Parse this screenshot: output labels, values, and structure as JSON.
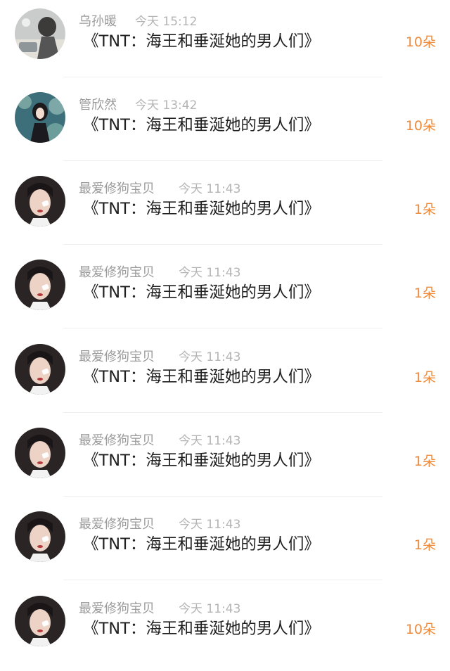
{
  "colors": {
    "username": "#9b9b9b",
    "time": "#b4b4b4",
    "text": "#1f1f1f",
    "accent": "#ef8a3a",
    "divider": "#eeeeee"
  },
  "gift_records": [
    {
      "username": "乌孙暖",
      "time": "今天 15:12",
      "gift": "《TNT：海王和垂涎她的男人们》",
      "count": "10朵",
      "avatar": "avatar-icon-a"
    },
    {
      "username": "管欣然",
      "time": "今天 13:42",
      "gift": "《TNT：海王和垂涎她的男人们》",
      "count": "10朵",
      "avatar": "avatar-icon-b"
    },
    {
      "username": "最爱修狗宝贝",
      "time": "今天 11:43",
      "gift": "《TNT：海王和垂涎她的男人们》",
      "count": "1朵",
      "avatar": "avatar-icon-c"
    },
    {
      "username": "最爱修狗宝贝",
      "time": "今天 11:43",
      "gift": "《TNT：海王和垂涎她的男人们》",
      "count": "1朵",
      "avatar": "avatar-icon-c"
    },
    {
      "username": "最爱修狗宝贝",
      "time": "今天 11:43",
      "gift": "《TNT：海王和垂涎她的男人们》",
      "count": "1朵",
      "avatar": "avatar-icon-c"
    },
    {
      "username": "最爱修狗宝贝",
      "time": "今天 11:43",
      "gift": "《TNT：海王和垂涎她的男人们》",
      "count": "1朵",
      "avatar": "avatar-icon-c"
    },
    {
      "username": "最爱修狗宝贝",
      "time": "今天 11:43",
      "gift": "《TNT：海王和垂涎她的男人们》",
      "count": "1朵",
      "avatar": "avatar-icon-c"
    },
    {
      "username": "最爱修狗宝贝",
      "time": "今天 11:43",
      "gift": "《TNT：海王和垂涎她的男人们》",
      "count": "10朵",
      "avatar": "avatar-icon-c"
    }
  ]
}
